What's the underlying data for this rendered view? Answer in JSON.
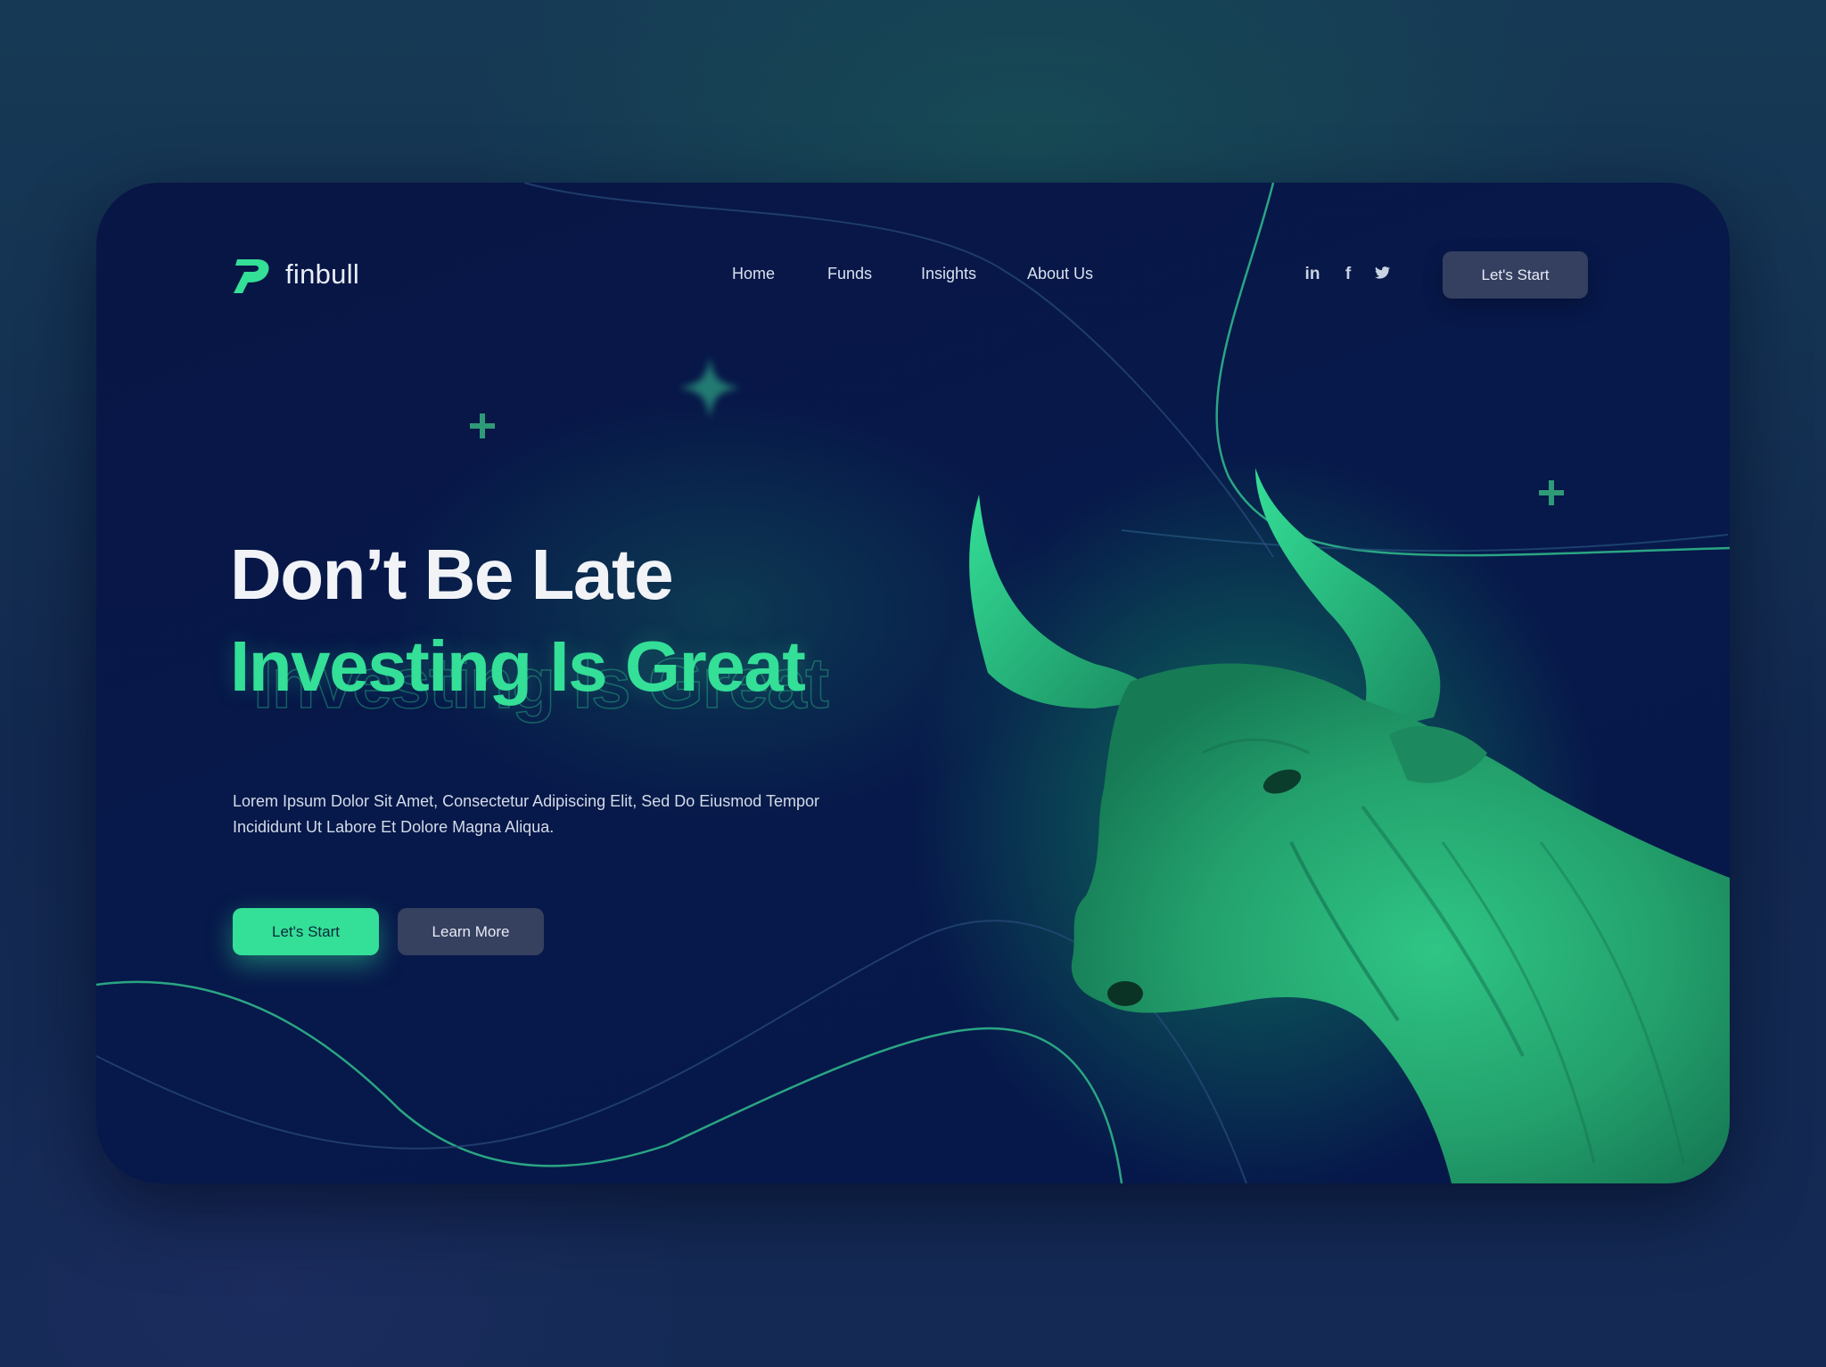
{
  "brand": {
    "name": "finbull",
    "accent": "#34df97",
    "background": "#07184a"
  },
  "nav": {
    "items": [
      {
        "label": "Home"
      },
      {
        "label": "Funds"
      },
      {
        "label": "Insights"
      },
      {
        "label": "About Us"
      }
    ],
    "social": [
      {
        "icon": "linkedin-icon",
        "glyph": "in"
      },
      {
        "icon": "facebook-icon",
        "glyph": "f"
      },
      {
        "icon": "twitter-icon",
        "glyph": "twitter"
      }
    ],
    "cta_label": "Let's Start"
  },
  "hero": {
    "title_line1": "Don’t Be Late",
    "title_line2": "Investing Is Great",
    "description_line1": "Lorem Ipsum Dolor Sit Amet, Consectetur Adipiscing Elit, Sed Do Eiusmod Tempor",
    "description_line2": "Incididunt Ut Labore Et Dolore Magna Aliqua.",
    "primary_button": "Let's Start",
    "secondary_button": "Learn More"
  },
  "decorations": {
    "image": "bull-statue-illustration",
    "plus_icon": "plus-icon",
    "sparkle_icon": "sparkle-icon"
  }
}
